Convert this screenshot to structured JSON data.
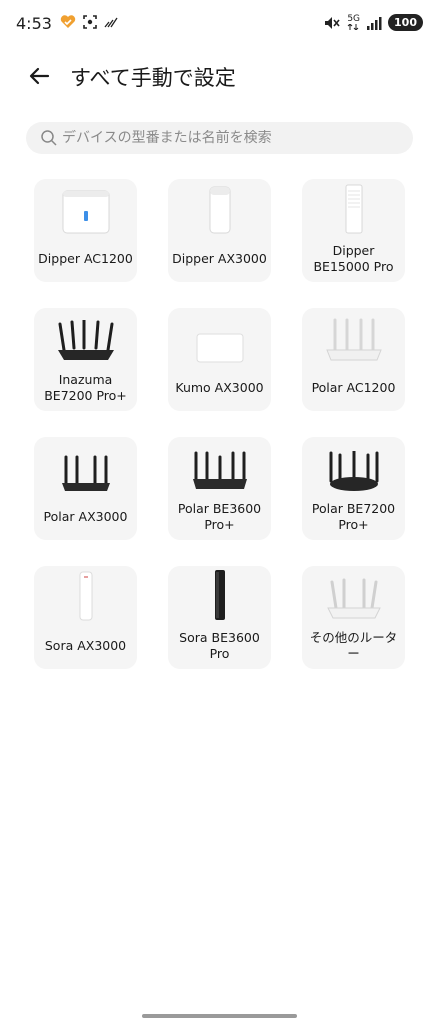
{
  "status_bar": {
    "time": "4:53",
    "network": "5G",
    "battery": "100"
  },
  "header": {
    "title": "すべて手動で設定"
  },
  "search": {
    "placeholder": "デバイスの型番または名前を検索"
  },
  "devices": [
    {
      "label": "Dipper AC1200",
      "icon": "white-box-router-icon"
    },
    {
      "label": "Dipper AX3000",
      "icon": "white-tower-router-icon"
    },
    {
      "label": "Dipper BE15000 Pro",
      "icon": "white-tall-tower-router-icon"
    },
    {
      "label": "Inazuma BE7200 Pro+",
      "icon": "black-antenna-router-icon"
    },
    {
      "label": "Kumo AX3000",
      "icon": "white-flat-router-icon"
    },
    {
      "label": "Polar AC1200",
      "icon": "white-antenna-router-icon"
    },
    {
      "label": "Polar AX3000",
      "icon": "black-antenna-router-icon"
    },
    {
      "label": "Polar BE3600 Pro+",
      "icon": "black-antenna-router-icon"
    },
    {
      "label": "Polar BE7200 Pro+",
      "icon": "black-antenna-router-icon"
    },
    {
      "label": "Sora AX3000",
      "icon": "white-slim-tower-router-icon"
    },
    {
      "label": "Sora BE3600 Pro",
      "icon": "black-tower-router-icon"
    },
    {
      "label": "その他のルーター",
      "icon": "white-antenna-router-icon"
    }
  ]
}
